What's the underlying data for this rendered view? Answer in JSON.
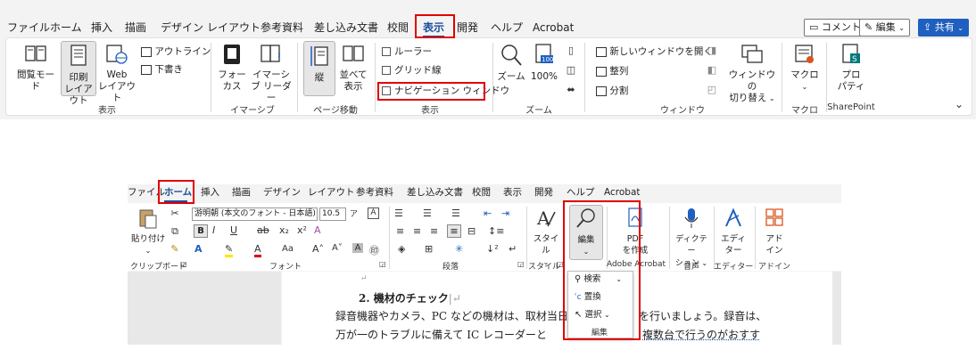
{
  "ribbon1": {
    "tabs": [
      "ファイル",
      "ホーム",
      "挿入",
      "描画",
      "デザイン",
      "レイアウト",
      "参考資料",
      "差し込み文書",
      "校閲",
      "表示",
      "開発",
      "ヘルプ",
      "Acrobat"
    ],
    "right_buttons": {
      "comment": "コメント",
      "edit": "編集",
      "share": "共有"
    },
    "views": {
      "read_mode": "閲覧モード",
      "print_layout_1": "印刷",
      "print_layout_2": "レイアウト",
      "web_1": "Web",
      "web_2": "レイアウト",
      "outline": "アウトライン",
      "draft": "下書き",
      "group": "表示"
    },
    "immersive": {
      "focus_1": "フォー",
      "focus_2": "カス",
      "reader_1": "イマーシ",
      "reader_2": "ブ リーダー",
      "group": "イマーシブ"
    },
    "page_move": {
      "vertical": "縦",
      "side_1": "並べて",
      "side_2": "表示",
      "group": "ページ移動"
    },
    "show": {
      "ruler": "ルーラー",
      "gridlines": "グリッド線",
      "nav_pane": "ナビゲーション ウィンドウ",
      "group": "表示"
    },
    "zoom": {
      "zoom": "ズーム",
      "percent": "100%",
      "group": "ズーム"
    },
    "window": {
      "new_window": "新しいウィンドウを開く",
      "arrange": "整列",
      "split": "分割",
      "switch_1": "ウィンドウの",
      "switch_2": "切り替え",
      "group": "ウィンドウ"
    },
    "macro": {
      "label": "マクロ",
      "group": "マクロ"
    },
    "sharepoint": {
      "label_1": "プロ",
      "label_2": "パティ",
      "group": "SharePoint"
    }
  },
  "ribbon2": {
    "tabs": [
      "ファイル",
      "ホーム",
      "挿入",
      "描画",
      "デザイン",
      "レイアウト",
      "参考資料",
      "差し込み文書",
      "校閲",
      "表示",
      "開発",
      "ヘルプ",
      "Acrobat"
    ],
    "clipboard": {
      "paste_1": "貼り付け",
      "group": "クリップボード"
    },
    "font": {
      "font_name": "游明朝 (本文のフォント - 日本語)",
      "font_size": "10.5",
      "change_case": "Aa",
      "group": "フォント"
    },
    "paragraph": {
      "group": "段落"
    },
    "styles": {
      "label": "スタイル",
      "group": "スタイル"
    },
    "editing": {
      "label": "編集",
      "dropdown": {
        "find": "検索",
        "replace": "置換",
        "select": "選択",
        "group": "編集"
      }
    },
    "acrobat": {
      "label_1": "PDF",
      "label_2": "を作成",
      "group": "Adobe Acrobat"
    },
    "voice": {
      "label_1": "ディクテー",
      "label_2": "ション",
      "group": "音声"
    },
    "editor": {
      "label_1": "エディ",
      "label_2": "ター",
      "group": "エディター"
    },
    "addins": {
      "label_1": "アド",
      "label_2": "イン",
      "group": "アドイン"
    }
  },
  "document": {
    "heading": "2.  機材のチェック",
    "line1": "録音機器やカメラ、PC などの機材は、取材当日",
    "line1b": "を行いましょう。録音は、",
    "line2": "万が一のトラブルに備えて IC レコーダーと",
    "line2b": "複数台で行うのがおすす"
  }
}
